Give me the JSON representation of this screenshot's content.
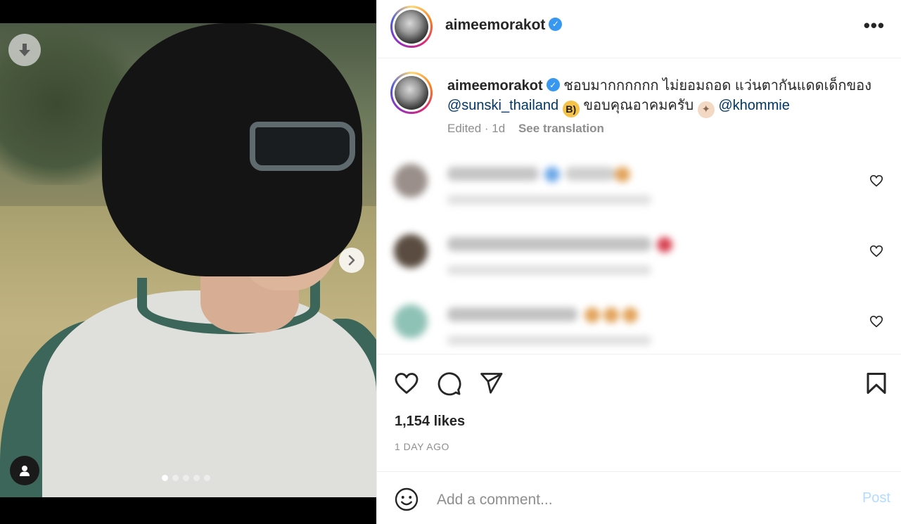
{
  "post": {
    "username": "aimeemorakot",
    "more_glyph": "•••",
    "verified_glyph": "✓"
  },
  "media": {
    "image_count": 5,
    "active_index": 0,
    "icons": [
      "download-icon",
      "chevron-right-icon",
      "user-tag-icon"
    ]
  },
  "caption": {
    "username": "aimeemorakot",
    "text_part1": "ชอบมากกกกกก ไม่ยอมถอด แว่นตากันแดดเด็กของ",
    "mention1": "@sunski_thailand",
    "emoji_cool": "😎",
    "text_part2": "ขอบคุณอาคมครับ",
    "emoji_pray": "🙏",
    "mention2": "@khommie",
    "meta": "Edited · 1d",
    "see_translation": "See translation"
  },
  "comments": {
    "count_visible": 3,
    "state": "blurred"
  },
  "actions": {
    "icons": [
      "heart-icon",
      "comment-icon",
      "share-icon",
      "bookmark-icon"
    ]
  },
  "likes": "1,154 likes",
  "date": "1 DAY AGO",
  "add_comment": {
    "placeholder": "Add a comment...",
    "post_label": "Post"
  },
  "colors": {
    "accent_blue": "#3897f0",
    "mention": "#00376b",
    "post_disabled": "#b3dbff",
    "muted": "#8e8e8e"
  }
}
